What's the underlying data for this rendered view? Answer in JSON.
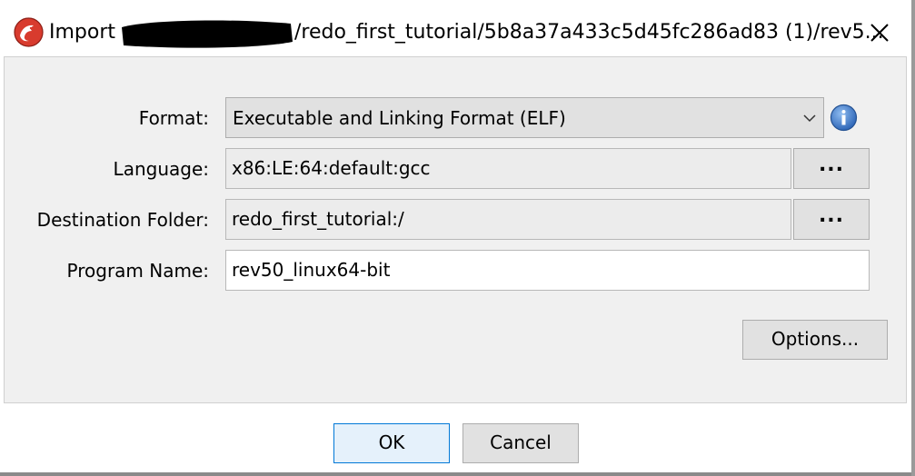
{
  "window": {
    "title_prefix": "Import",
    "title_path": "/redo_first_tutorial/5b8a37a433c5d45fc286ad83 (1)/rev5...",
    "close_label": "close-icon",
    "app_icon": "dragon-icon"
  },
  "form": {
    "format": {
      "label": "Format:",
      "value": "Executable and Linking Format (ELF)"
    },
    "language": {
      "label": "Language:",
      "value": "x86:LE:64:default:gcc",
      "browse_label": "..."
    },
    "destination": {
      "label": "Destination Folder:",
      "value": "redo_first_tutorial:/",
      "browse_label": "..."
    },
    "program_name": {
      "label": "Program Name:",
      "value": "rev50_linux64-bit"
    },
    "options_label": "Options..."
  },
  "footer": {
    "ok_label": "OK",
    "cancel_label": "Cancel"
  },
  "colors": {
    "accent": "#0078d7",
    "info_blue": "#3a78c8",
    "icon_red": "#d83b2e"
  }
}
